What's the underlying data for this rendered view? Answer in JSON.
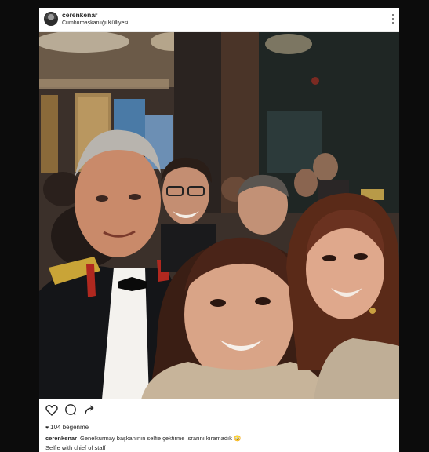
{
  "post": {
    "username": "cerenkenar",
    "location": "Cumhurbaşkanlığı Külliyesi",
    "likes": "104 beğenme",
    "caption_user": "cerenkenar",
    "caption_text": "Genelkurmay başkanının selfie çektirme ısrarını kıramadık 😳",
    "caption_line2": "Selfie with chief of staff"
  },
  "icons": {
    "avatar": "profile-avatar",
    "more": "more-options-icon",
    "like": "heart-icon",
    "comment": "comment-icon",
    "share": "share-icon"
  },
  "colors": {
    "frame": "#0c0c0c",
    "card": "#ffffff",
    "text": "#262626"
  }
}
